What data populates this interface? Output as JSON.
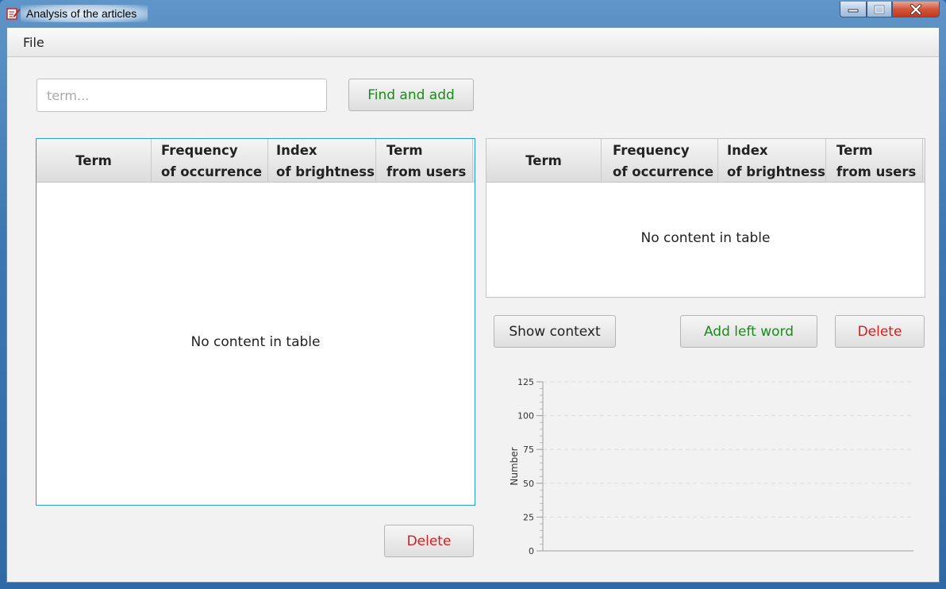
{
  "window": {
    "title": "Analysis of the articles",
    "controls": {
      "minimize": "minimize-icon",
      "maximize": "maximize-icon",
      "close": "close-icon"
    }
  },
  "menu": {
    "items": [
      "File"
    ]
  },
  "search": {
    "placeholder": "term...",
    "value": ""
  },
  "buttons": {
    "find_and_add": "Find and add",
    "show_context": "Show context",
    "add_left_word": "Add left word",
    "delete_right": "Delete",
    "delete_left": "Delete"
  },
  "left_table": {
    "columns": [
      {
        "line1": "Term",
        "line2": ""
      },
      {
        "line1": "Frequency",
        "line2": "of occurrence"
      },
      {
        "line1": "Index",
        "line2": "of brightness"
      },
      {
        "line1": "Term",
        "line2": "from users"
      }
    ],
    "rows": [],
    "empty_text": "No content in table"
  },
  "right_table": {
    "columns": [
      {
        "line1": "Term",
        "line2": ""
      },
      {
        "line1": "Frequency",
        "line2": "of occurrence"
      },
      {
        "line1": "Index",
        "line2": "of brightness"
      },
      {
        "line1": "Term",
        "line2": "from users"
      }
    ],
    "rows": [],
    "empty_text": "No content in table"
  },
  "colors": {
    "green_text": "#1a8a1a",
    "red_text": "#d81b1b",
    "focus_border": "#2b9bd6"
  },
  "chart_data": {
    "type": "bar",
    "categories": [],
    "series": [],
    "ylabel": "Number",
    "xlabel": "",
    "ylim": [
      0,
      125
    ],
    "yticks": [
      "0",
      "25",
      "50",
      "75",
      "100",
      "125"
    ],
    "grid": true
  }
}
